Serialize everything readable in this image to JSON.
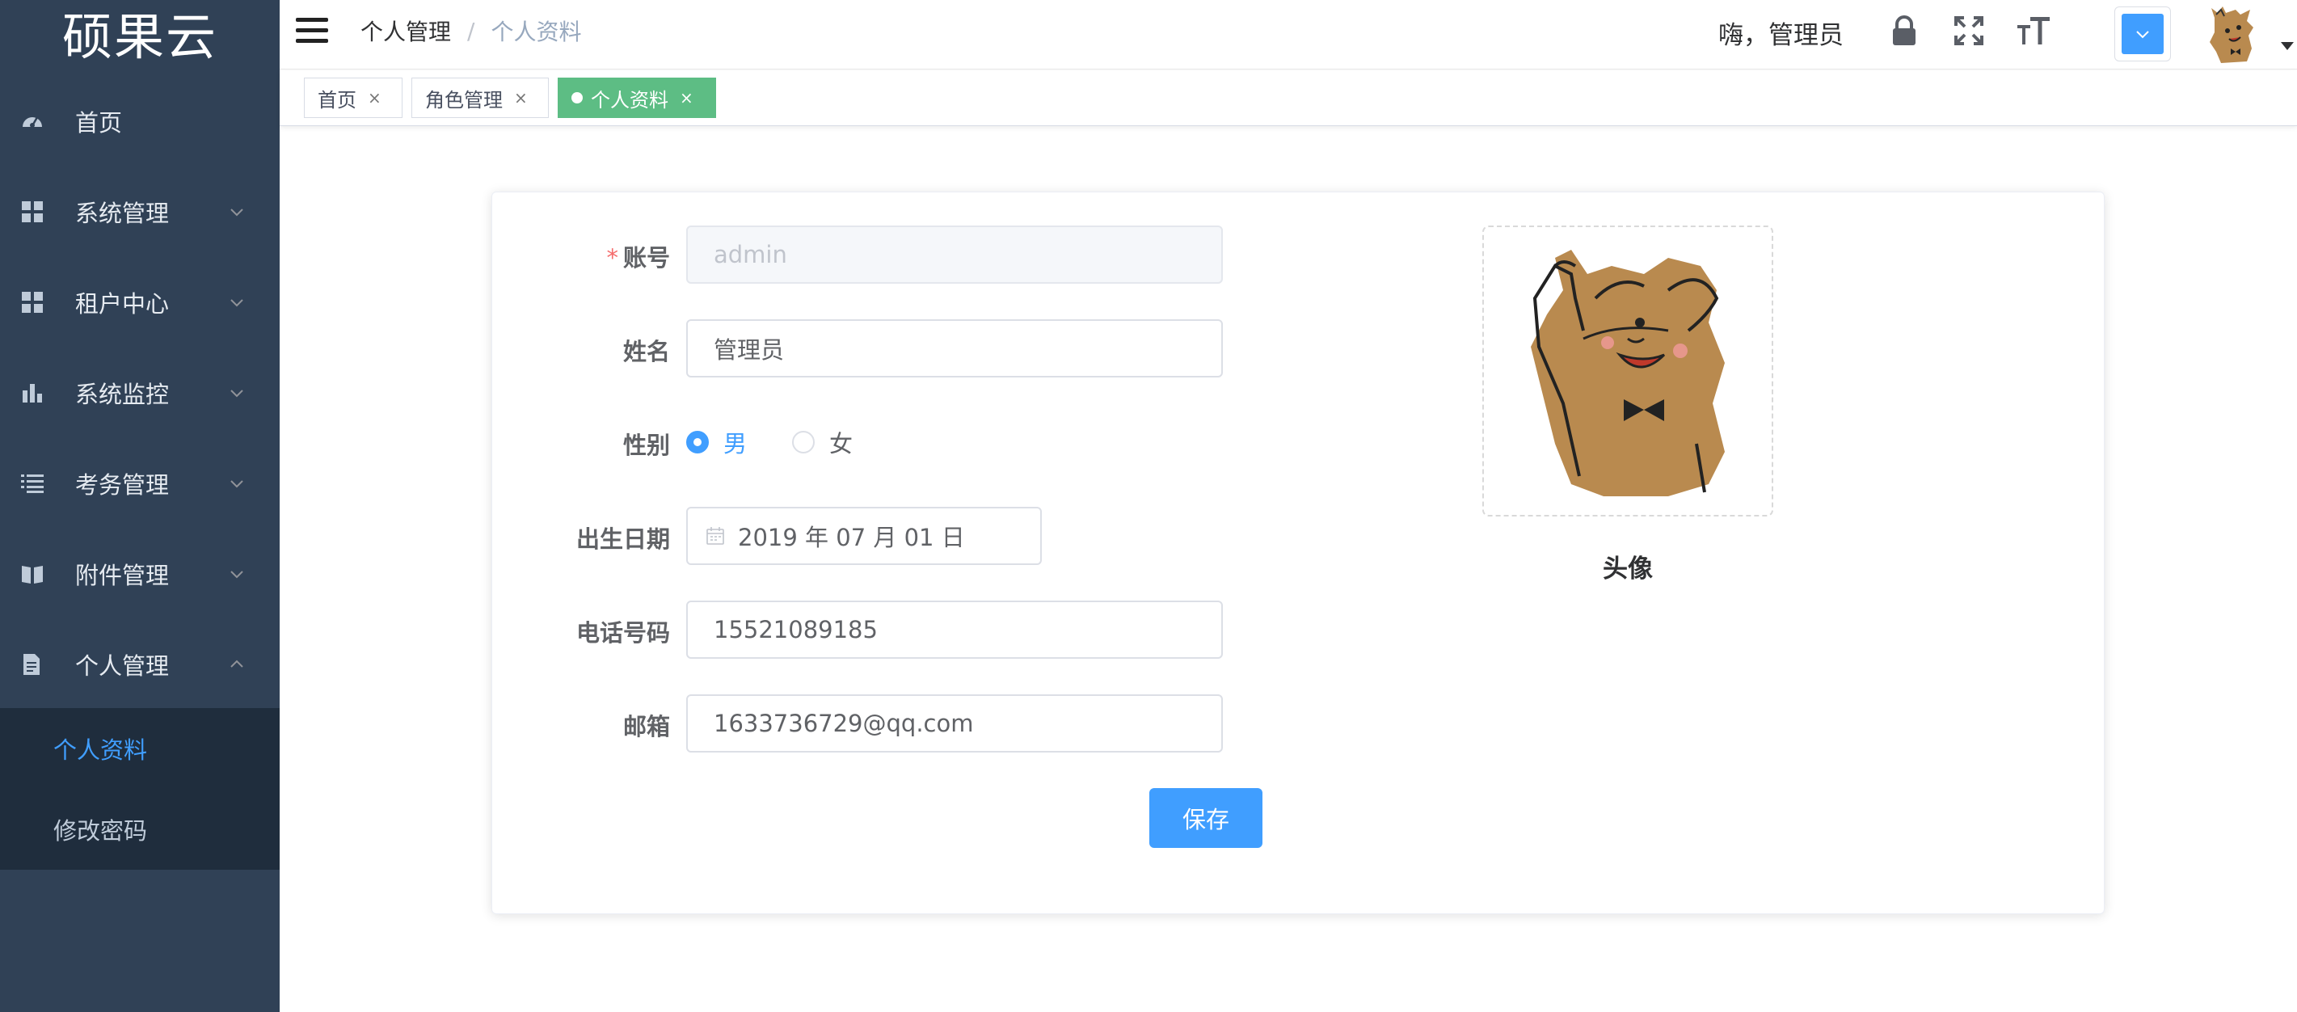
{
  "app": {
    "logo": "硕果云"
  },
  "sidebar": {
    "items": [
      {
        "label": "首页",
        "icon": "dashboard-icon"
      },
      {
        "label": "系统管理",
        "icon": "grid-icon"
      },
      {
        "label": "租户中心",
        "icon": "grid-icon"
      },
      {
        "label": "系统监控",
        "icon": "bar-chart-icon"
      },
      {
        "label": "考务管理",
        "icon": "list-icon"
      },
      {
        "label": "附件管理",
        "icon": "book-icon"
      },
      {
        "label": "个人管理",
        "icon": "document-icon"
      }
    ],
    "submenu": [
      {
        "label": "个人资料",
        "active": true
      },
      {
        "label": "修改密码",
        "active": false
      }
    ]
  },
  "navbar": {
    "breadcrumb": [
      "个人管理",
      "/",
      "个人资料"
    ],
    "greeting": "嗨，管理员",
    "theme_color": "#409eff"
  },
  "tags": [
    {
      "label": "首页",
      "close": "×",
      "active": false
    },
    {
      "label": "角色管理",
      "close": "×",
      "active": false
    },
    {
      "label": "个人资料",
      "close": "×",
      "active": true
    }
  ],
  "form": {
    "account_label": "账号",
    "account_required": "*",
    "account_placeholder": "admin",
    "name_label": "姓名",
    "name_value": "管理员",
    "gender_label": "性别",
    "gender_options": [
      "男",
      "女"
    ],
    "gender_selected": "男",
    "birthday_label": "出生日期",
    "birthday_value": "2019 年 07 月 01 日",
    "phone_label": "电话号码",
    "phone_value": "15521089185",
    "email_label": "邮箱",
    "email_value": "1633736729@qq.com",
    "save_label": "保存",
    "avatar_caption": "头像"
  }
}
